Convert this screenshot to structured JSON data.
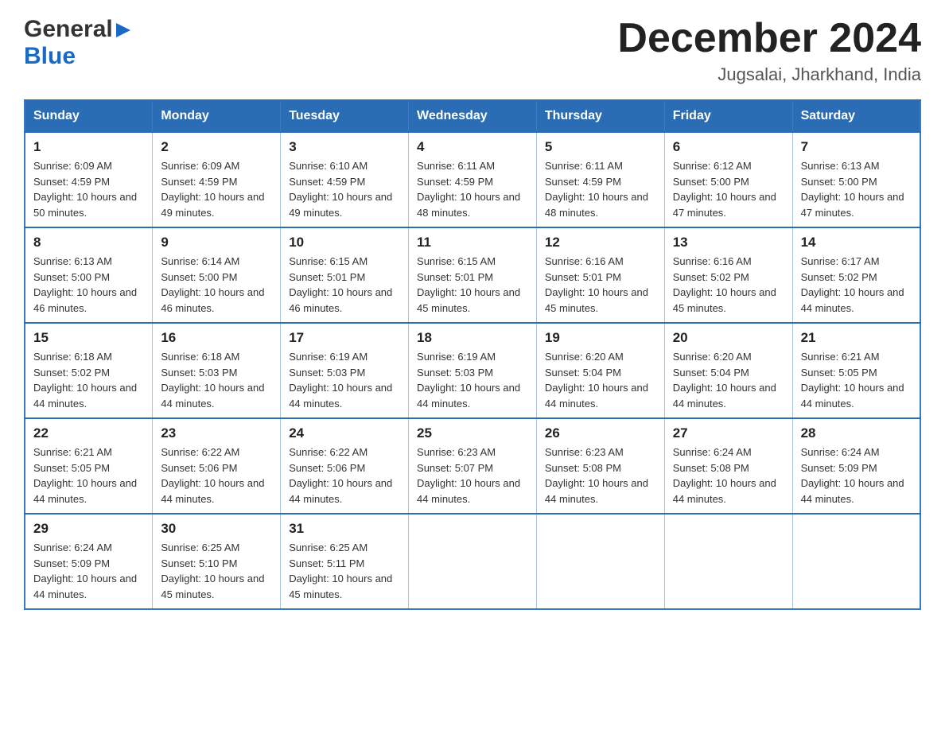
{
  "header": {
    "logo_general": "General",
    "logo_blue": "Blue",
    "month_title": "December 2024",
    "location": "Jugsalai, Jharkhand, India"
  },
  "calendar": {
    "days_of_week": [
      "Sunday",
      "Monday",
      "Tuesday",
      "Wednesday",
      "Thursday",
      "Friday",
      "Saturday"
    ],
    "weeks": [
      [
        {
          "date": "1",
          "sunrise": "6:09 AM",
          "sunset": "4:59 PM",
          "daylight": "10 hours and 50 minutes."
        },
        {
          "date": "2",
          "sunrise": "6:09 AM",
          "sunset": "4:59 PM",
          "daylight": "10 hours and 49 minutes."
        },
        {
          "date": "3",
          "sunrise": "6:10 AM",
          "sunset": "4:59 PM",
          "daylight": "10 hours and 49 minutes."
        },
        {
          "date": "4",
          "sunrise": "6:11 AM",
          "sunset": "4:59 PM",
          "daylight": "10 hours and 48 minutes."
        },
        {
          "date": "5",
          "sunrise": "6:11 AM",
          "sunset": "4:59 PM",
          "daylight": "10 hours and 48 minutes."
        },
        {
          "date": "6",
          "sunrise": "6:12 AM",
          "sunset": "5:00 PM",
          "daylight": "10 hours and 47 minutes."
        },
        {
          "date": "7",
          "sunrise": "6:13 AM",
          "sunset": "5:00 PM",
          "daylight": "10 hours and 47 minutes."
        }
      ],
      [
        {
          "date": "8",
          "sunrise": "6:13 AM",
          "sunset": "5:00 PM",
          "daylight": "10 hours and 46 minutes."
        },
        {
          "date": "9",
          "sunrise": "6:14 AM",
          "sunset": "5:00 PM",
          "daylight": "10 hours and 46 minutes."
        },
        {
          "date": "10",
          "sunrise": "6:15 AM",
          "sunset": "5:01 PM",
          "daylight": "10 hours and 46 minutes."
        },
        {
          "date": "11",
          "sunrise": "6:15 AM",
          "sunset": "5:01 PM",
          "daylight": "10 hours and 45 minutes."
        },
        {
          "date": "12",
          "sunrise": "6:16 AM",
          "sunset": "5:01 PM",
          "daylight": "10 hours and 45 minutes."
        },
        {
          "date": "13",
          "sunrise": "6:16 AM",
          "sunset": "5:02 PM",
          "daylight": "10 hours and 45 minutes."
        },
        {
          "date": "14",
          "sunrise": "6:17 AM",
          "sunset": "5:02 PM",
          "daylight": "10 hours and 44 minutes."
        }
      ],
      [
        {
          "date": "15",
          "sunrise": "6:18 AM",
          "sunset": "5:02 PM",
          "daylight": "10 hours and 44 minutes."
        },
        {
          "date": "16",
          "sunrise": "6:18 AM",
          "sunset": "5:03 PM",
          "daylight": "10 hours and 44 minutes."
        },
        {
          "date": "17",
          "sunrise": "6:19 AM",
          "sunset": "5:03 PM",
          "daylight": "10 hours and 44 minutes."
        },
        {
          "date": "18",
          "sunrise": "6:19 AM",
          "sunset": "5:03 PM",
          "daylight": "10 hours and 44 minutes."
        },
        {
          "date": "19",
          "sunrise": "6:20 AM",
          "sunset": "5:04 PM",
          "daylight": "10 hours and 44 minutes."
        },
        {
          "date": "20",
          "sunrise": "6:20 AM",
          "sunset": "5:04 PM",
          "daylight": "10 hours and 44 minutes."
        },
        {
          "date": "21",
          "sunrise": "6:21 AM",
          "sunset": "5:05 PM",
          "daylight": "10 hours and 44 minutes."
        }
      ],
      [
        {
          "date": "22",
          "sunrise": "6:21 AM",
          "sunset": "5:05 PM",
          "daylight": "10 hours and 44 minutes."
        },
        {
          "date": "23",
          "sunrise": "6:22 AM",
          "sunset": "5:06 PM",
          "daylight": "10 hours and 44 minutes."
        },
        {
          "date": "24",
          "sunrise": "6:22 AM",
          "sunset": "5:06 PM",
          "daylight": "10 hours and 44 minutes."
        },
        {
          "date": "25",
          "sunrise": "6:23 AM",
          "sunset": "5:07 PM",
          "daylight": "10 hours and 44 minutes."
        },
        {
          "date": "26",
          "sunrise": "6:23 AM",
          "sunset": "5:08 PM",
          "daylight": "10 hours and 44 minutes."
        },
        {
          "date": "27",
          "sunrise": "6:24 AM",
          "sunset": "5:08 PM",
          "daylight": "10 hours and 44 minutes."
        },
        {
          "date": "28",
          "sunrise": "6:24 AM",
          "sunset": "5:09 PM",
          "daylight": "10 hours and 44 minutes."
        }
      ],
      [
        {
          "date": "29",
          "sunrise": "6:24 AM",
          "sunset": "5:09 PM",
          "daylight": "10 hours and 44 minutes."
        },
        {
          "date": "30",
          "sunrise": "6:25 AM",
          "sunset": "5:10 PM",
          "daylight": "10 hours and 45 minutes."
        },
        {
          "date": "31",
          "sunrise": "6:25 AM",
          "sunset": "5:11 PM",
          "daylight": "10 hours and 45 minutes."
        },
        null,
        null,
        null,
        null
      ]
    ]
  }
}
